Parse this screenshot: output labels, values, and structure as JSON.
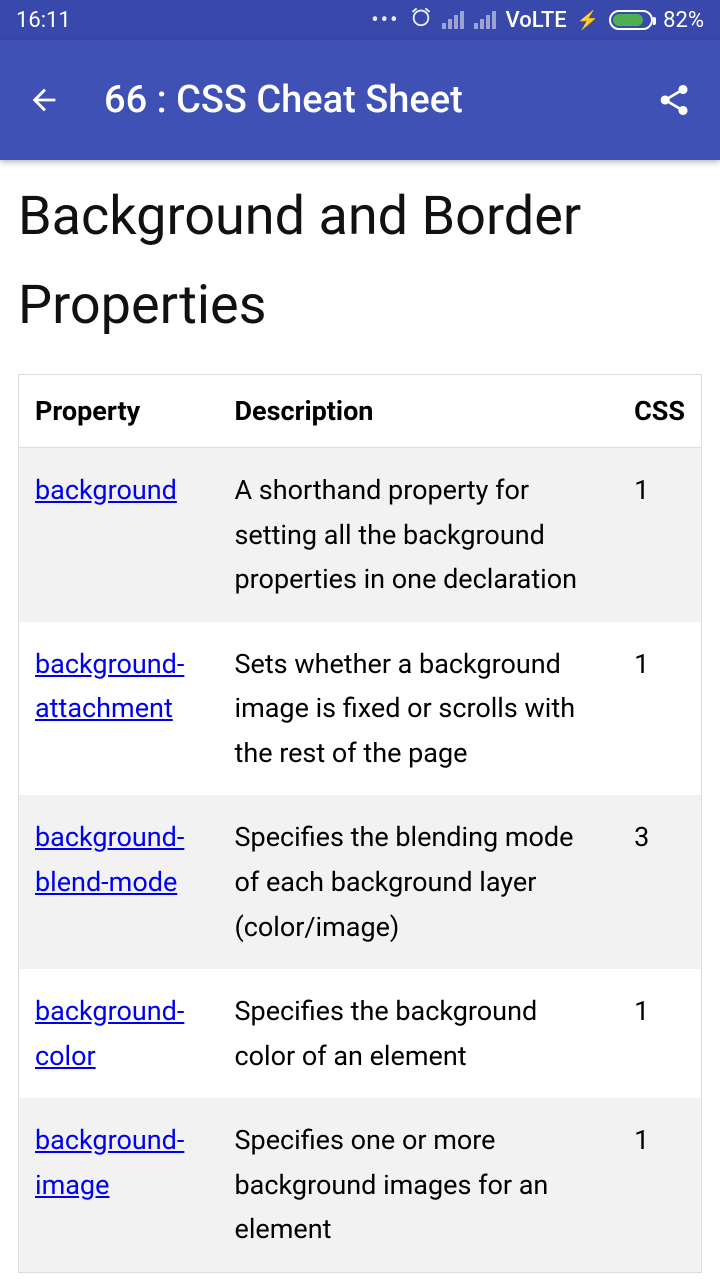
{
  "statusBar": {
    "time": "16:11",
    "volte": "VoLTE",
    "batteryPercent": "82%"
  },
  "appBar": {
    "title": "66 : CSS Cheat Sheet"
  },
  "page": {
    "heading": "Background and Border Properties"
  },
  "table": {
    "headers": {
      "property": "Property",
      "description": "Description",
      "css": "CSS"
    },
    "rows": [
      {
        "property": "background",
        "description": "A shorthand property for setting all the background properties in one declaration",
        "css": "1"
      },
      {
        "property": "background-attachment",
        "description": "Sets whether a background image is fixed or scrolls with the rest of the page",
        "css": "1"
      },
      {
        "property": "background-blend-mode",
        "description": "Specifies the blending mode of each background layer (color/image)",
        "css": "3"
      },
      {
        "property": "background-color",
        "description": "Specifies the background color of an element",
        "css": "1"
      },
      {
        "property": "background-image",
        "description": "Specifies one or more background images for an element",
        "css": "1"
      }
    ]
  }
}
